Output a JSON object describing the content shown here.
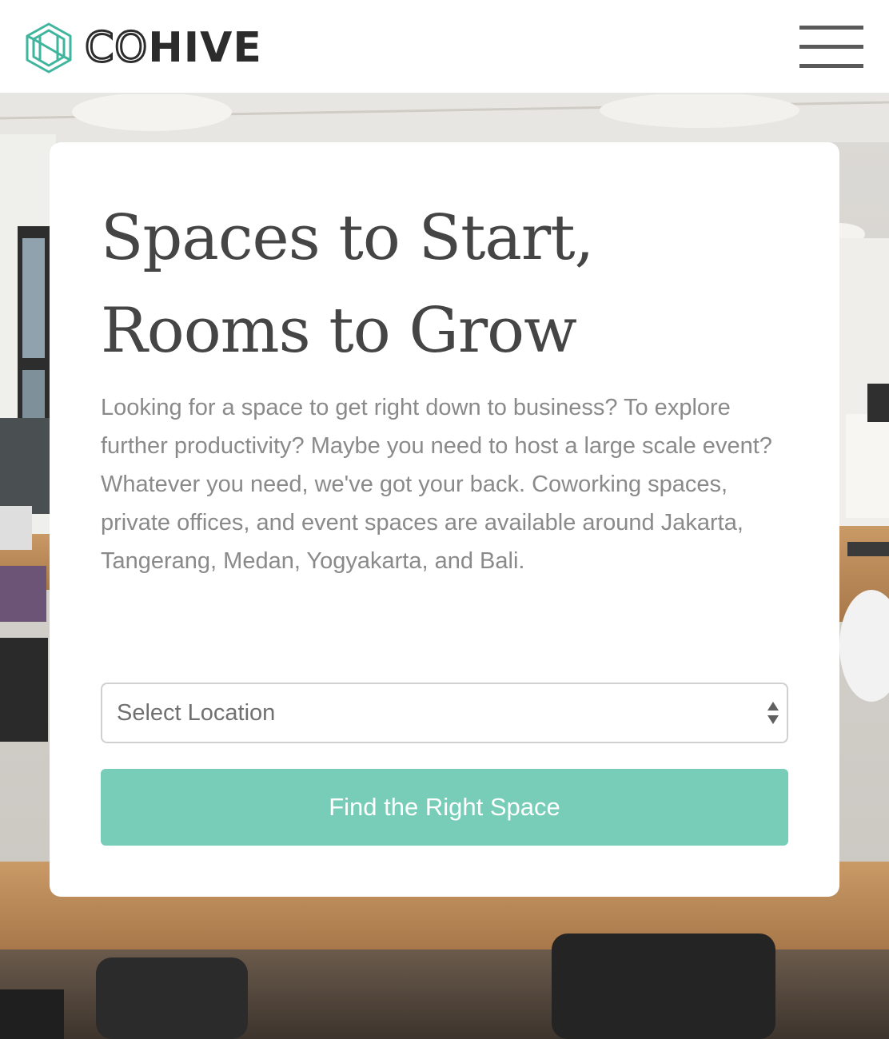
{
  "brand": {
    "name_outline": "CO",
    "name_bold": "HIVE",
    "accent_color": "#3fb59d"
  },
  "header": {
    "menu_icon": "hamburger-menu-icon"
  },
  "hero": {
    "background": "coworking office interior photo",
    "headline": "Spaces to Start, Rooms to Grow",
    "description": "Looking for a space to get right down to business? To explore further productivity? Maybe you need to host a large scale event? Whatever you need, we've got your back. Coworking spaces, private offices, and event spaces are available around Jakarta, Tangerang, Medan, Yogyakarta, and Bali.",
    "location_select": {
      "selected": "Select Location",
      "icon": "select-updown-arrows-icon"
    },
    "cta_label": "Find the Right Space",
    "cta_color": "#78cdb8"
  }
}
